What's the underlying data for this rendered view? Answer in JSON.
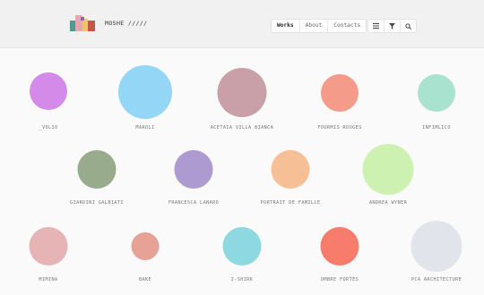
{
  "header": {
    "brand": "MOSHE /////",
    "logo_colors": [
      "#4f9a8e",
      "#e8a7ae",
      "#f0c46b",
      "#c5554d",
      "#8a6aa3"
    ],
    "nav": [
      {
        "label": "Works",
        "active": true
      },
      {
        "label": "About",
        "active": false
      },
      {
        "label": "Contacts",
        "active": false
      }
    ],
    "tools": [
      "list-icon",
      "filter-icon",
      "search-icon"
    ]
  },
  "projects": [
    {
      "label": "_VOLIO",
      "color": "#d48ae8"
    },
    {
      "label": "MAROLI",
      "color": "#93d6f5"
    },
    {
      "label": "ACETAIA VILLA BIANCA",
      "color": "#c9a0a7"
    },
    {
      "label": "FOURMIS ROUGES",
      "color": "#f59b8a"
    },
    {
      "label": "INFIMLICO",
      "color": "#a9e2cf"
    },
    {
      "label": "GIARDINI GALBIATI",
      "color": "#98ab8c"
    },
    {
      "label": "FRANCESCA LANARO",
      "color": "#ac9ad0"
    },
    {
      "label": "PORTRAIT DE FAMILLE",
      "color": "#f6bf95"
    },
    {
      "label": "ANDREA WYNER",
      "color": "#ccf1b0"
    },
    {
      "label": "MIMINA",
      "color": "#e7b4b6"
    },
    {
      "label": "BAKE",
      "color": "#e8a195"
    },
    {
      "label": "I-SHIRK",
      "color": "#8ed8e1"
    },
    {
      "label": "OMBRE FORTÈS",
      "color": "#f77c6c"
    },
    {
      "label": "PCA ARCHITECTURE",
      "color": "#e2e4ec"
    }
  ]
}
